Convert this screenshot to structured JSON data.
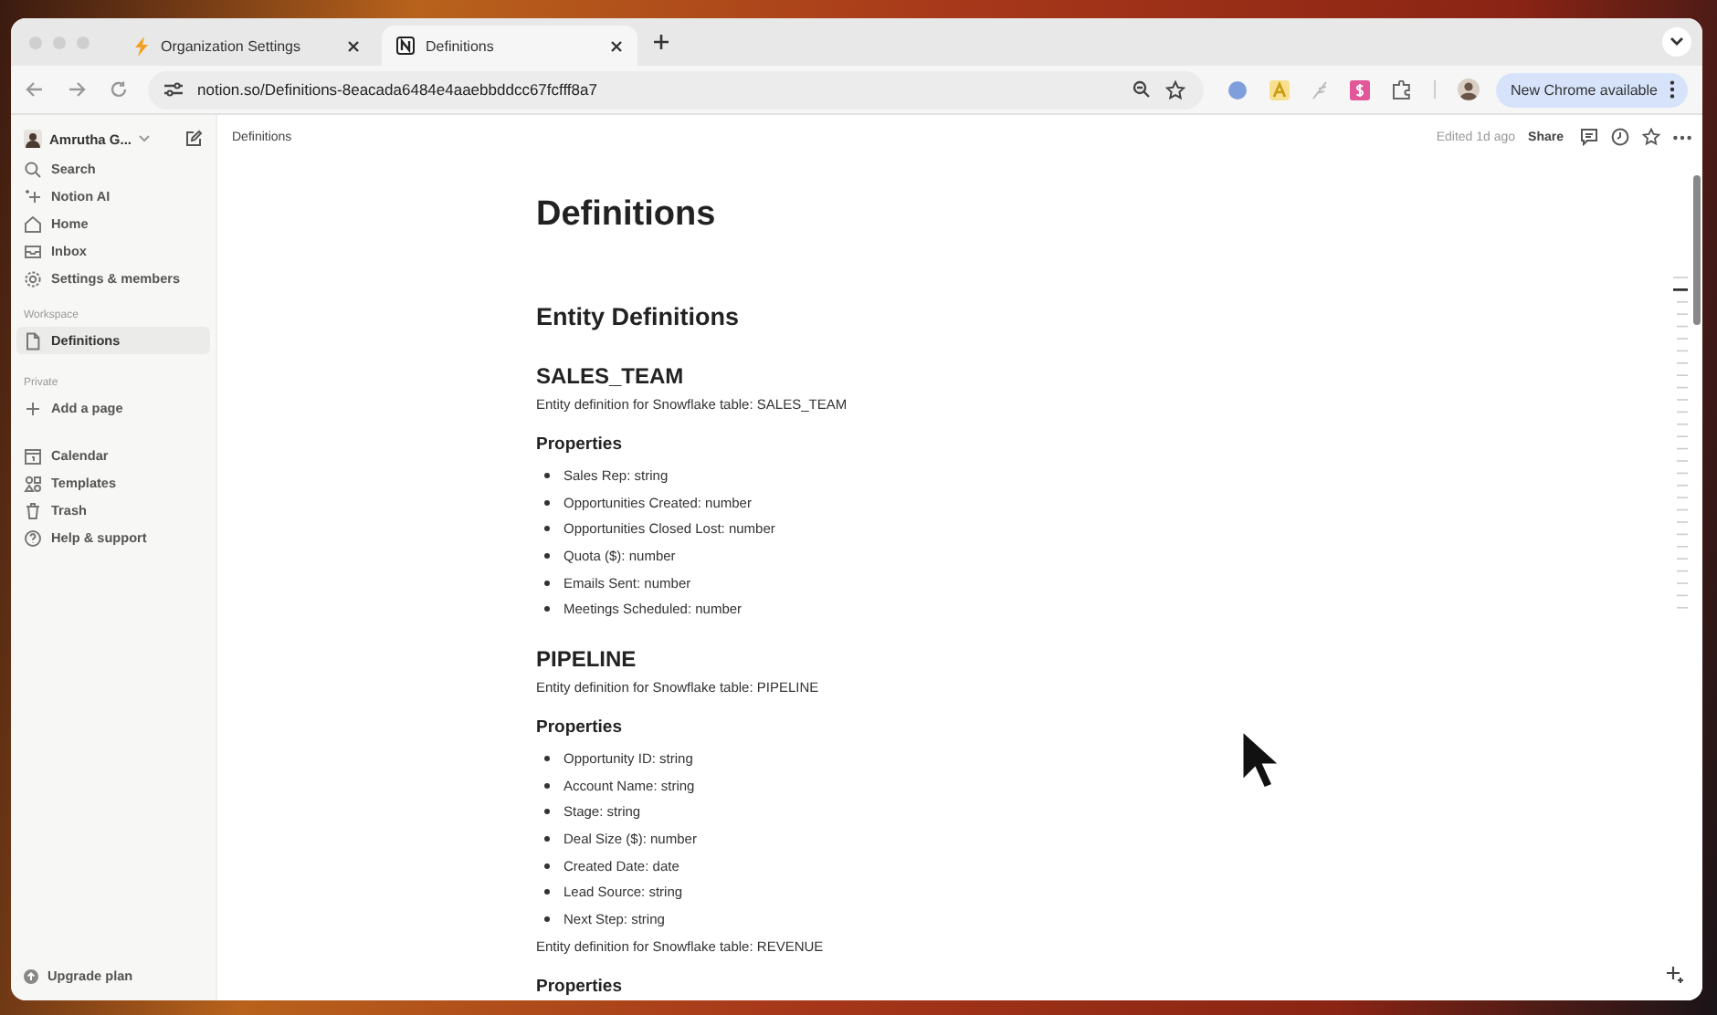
{
  "browser": {
    "tabs": [
      {
        "title": "Organization Settings",
        "selected": false
      },
      {
        "title": "Definitions",
        "selected": true
      }
    ],
    "url": "notion.so/Definitions-8eacada6484e4aaebbddcc67fcfff8a7",
    "update_button": "New Chrome available"
  },
  "sidebar": {
    "user": "Amrutha G...",
    "nav": [
      {
        "label": "Search",
        "selected": false
      },
      {
        "label": "Notion AI",
        "selected": false
      },
      {
        "label": "Home",
        "selected": false
      },
      {
        "label": "Inbox",
        "selected": false
      },
      {
        "label": "Settings & members",
        "selected": false
      }
    ],
    "sections": [
      {
        "label": "Workspace",
        "items": [
          {
            "label": "Definitions",
            "selected": true
          }
        ]
      },
      {
        "label": "Private",
        "items": [
          {
            "label": "Add a page",
            "selected": false
          }
        ]
      }
    ],
    "bottom_nav": [
      {
        "label": "Calendar",
        "selected": false
      },
      {
        "label": "Templates",
        "selected": false
      },
      {
        "label": "Trash",
        "selected": false
      },
      {
        "label": "Help & support",
        "selected": false
      }
    ],
    "upgrade": "Upgrade plan"
  },
  "topbar": {
    "breadcrumb": "Definitions",
    "edited": "Edited 1d ago",
    "share": "Share"
  },
  "document": {
    "blocks": [
      {
        "kind": "title",
        "text": "Definitions"
      },
      {
        "kind": "heading1",
        "text": "Entity Definitions"
      },
      {
        "kind": "heading2",
        "text": "SALES_TEAM"
      },
      {
        "kind": "text",
        "text": "Entity definition for Snowflake table: SALES_TEAM"
      },
      {
        "kind": "heading3",
        "text": "Properties"
      },
      {
        "kind": "bullets",
        "items": [
          "Sales Rep: string",
          "Opportunities Created: number",
          "Opportunities Closed Lost: number",
          "Quota ($): number",
          "Emails Sent: number",
          "Meetings Scheduled: number"
        ]
      },
      {
        "kind": "heading2",
        "text": "PIPELINE"
      },
      {
        "kind": "text",
        "text": "Entity definition for Snowflake table: PIPELINE"
      },
      {
        "kind": "heading3",
        "text": "Properties"
      },
      {
        "kind": "bullets",
        "items": [
          "Opportunity ID: string",
          "Account Name: string",
          "Stage: string",
          "Deal Size ($): number",
          "Created Date: date",
          "Lead Source: string",
          "Next Step: string"
        ]
      },
      {
        "kind": "text",
        "text": "Entity definition for Snowflake table: REVENUE"
      },
      {
        "kind": "heading3",
        "text": "Properties"
      }
    ]
  }
}
